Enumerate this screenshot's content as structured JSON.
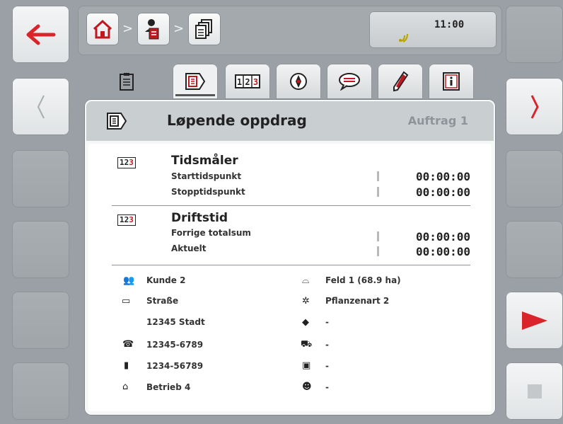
{
  "header": {
    "clock": "11:00",
    "breadcrumb": [
      {
        "name": "home",
        "icon": "home-icon"
      },
      {
        "name": "order-management",
        "icon": "person-document-icon"
      },
      {
        "name": "orders",
        "icon": "document-stack-icon"
      }
    ],
    "separator": ">"
  },
  "tabs": [
    {
      "icon": "clipboard-icon",
      "active": false
    },
    {
      "icon": "running-order-icon",
      "active": true
    },
    {
      "icon": "counter-icon",
      "active": false
    },
    {
      "icon": "compass-icon",
      "active": false
    },
    {
      "icon": "comment-icon",
      "active": false
    },
    {
      "icon": "pencil-icon",
      "active": false
    },
    {
      "icon": "info-document-icon",
      "active": false
    }
  ],
  "panel": {
    "title": "Løpende oppdrag",
    "subtitle": "Auftrag 1"
  },
  "sections": [
    {
      "title": "Tidsmåler",
      "icon_text": "12",
      "rows": [
        {
          "label": "Starttidspunkt",
          "value": "00:00:00"
        },
        {
          "label": "Stopptidspunkt",
          "value": "00:00:00"
        }
      ]
    },
    {
      "title": "Driftstid",
      "icon_text": "12",
      "rows": [
        {
          "label": "Forrige totalsum",
          "value": "00:00:00"
        },
        {
          "label": "Aktuelt",
          "value": "00:00:00"
        }
      ]
    }
  ],
  "info_left": [
    {
      "icon": "customer-icon",
      "glyph": "👥",
      "text": "Kunde 2"
    },
    {
      "icon": "address-icon",
      "glyph": "▭",
      "text": "Straße"
    },
    {
      "icon": "",
      "glyph": "",
      "text": "12345 Stadt"
    },
    {
      "icon": "telephone-icon",
      "glyph": "☎",
      "text": "12345-6789"
    },
    {
      "icon": "mobile-phone-icon",
      "glyph": "▮",
      "text": "1234-56789"
    },
    {
      "icon": "farm-icon",
      "glyph": "⌂",
      "text": "Betrieb 4"
    }
  ],
  "info_right": [
    {
      "icon": "field-icon",
      "glyph": "⌓",
      "text": "Feld 1 (68.9 ha)"
    },
    {
      "icon": "plant-icon",
      "glyph": "✲",
      "text": "Pflanzenart 2"
    },
    {
      "icon": "product-icon",
      "glyph": "◆",
      "text": "-"
    },
    {
      "icon": "tractor-icon",
      "glyph": "⛟",
      "text": "-"
    },
    {
      "icon": "machine-icon",
      "glyph": "▣",
      "text": "-"
    },
    {
      "icon": "driver-icon",
      "glyph": "☻",
      "text": "-"
    }
  ],
  "colors": {
    "accent_red": "#d9242c",
    "background": "#9aa0a6",
    "panel_header": "#c9ced1"
  }
}
